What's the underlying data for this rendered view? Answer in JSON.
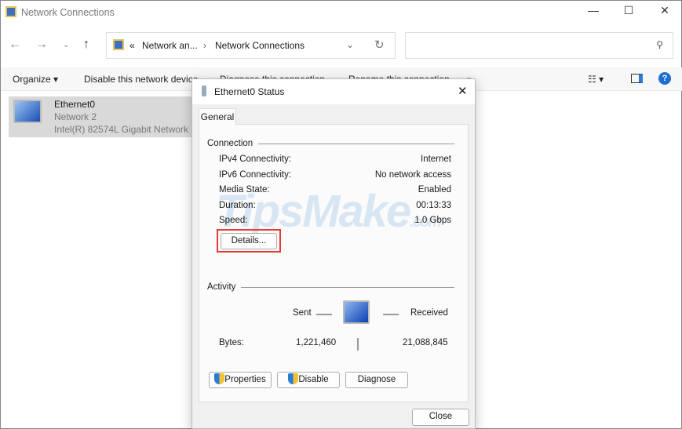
{
  "window": {
    "title": "Network Connections"
  },
  "address": {
    "overflow": "«",
    "crumbs": [
      "Network an...",
      "Network Connections"
    ],
    "search_placeholder": ""
  },
  "toolbar": {
    "organize": "Organize",
    "disable": "Disable this network device",
    "diagnose": "Diagnose this connection",
    "rename": "Rename this connection",
    "more": "»"
  },
  "item": {
    "name": "Ethernet0",
    "network": "Network 2",
    "adapter": "Intel(R) 82574L Gigabit Network C"
  },
  "dialog": {
    "title": "Ethernet0 Status",
    "tab": "General",
    "connection": {
      "heading": "Connection",
      "rows": [
        {
          "label": "IPv4 Connectivity:",
          "value": "Internet"
        },
        {
          "label": "IPv6 Connectivity:",
          "value": "No network access"
        },
        {
          "label": "Media State:",
          "value": "Enabled"
        },
        {
          "label": "Duration:",
          "value": "00:13:33"
        },
        {
          "label": "Speed:",
          "value": "1.0 Gbps"
        }
      ]
    },
    "details": "Details...",
    "activity": {
      "heading": "Activity",
      "sent": "Sent",
      "received": "Received",
      "bytes_label": "Bytes:",
      "bytes_sent": "1,221,460",
      "bytes_received": "21,088,845"
    },
    "buttons": {
      "properties": "Properties",
      "disable": "Disable",
      "diagnose": "Diagnose",
      "close": "Close"
    }
  },
  "watermark": "TipsMake.com",
  "colors": {
    "highlight": "#e53935",
    "selection": "#d9d9d9"
  }
}
